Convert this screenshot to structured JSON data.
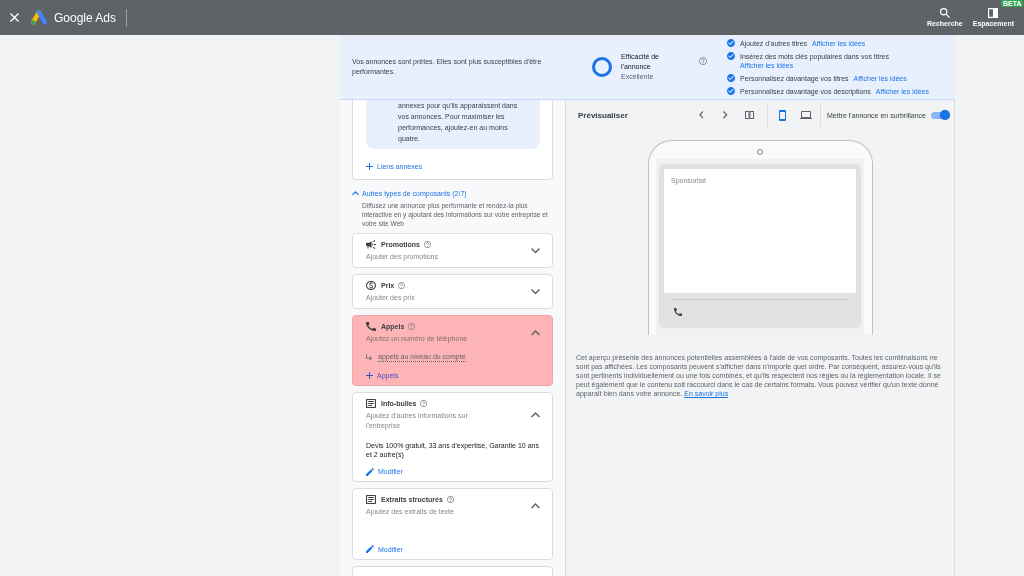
{
  "top_bar": {
    "product": "Google Ads",
    "actions": [
      {
        "kind": "search",
        "label": "Recherche"
      },
      {
        "kind": "layout",
        "label": "Espacement",
        "badge": "BETA"
      }
    ]
  },
  "banner": {
    "message": "Vos annonces sont prêtes. Elles sont plus susceptibles d'être performantes.",
    "strength": {
      "title": "Efficacité de l'annonce",
      "rating": "Excellente",
      "level": 1
    },
    "suggestions": [
      {
        "text": "Ajoutez d'autres titres",
        "link": "Afficher les idées",
        "done": true
      },
      {
        "text": "Insérez des mots clés populaires dans vos titres",
        "link": "Afficher les idées",
        "done": true
      },
      {
        "text": "Personnalisez davantage vos titres",
        "link": "Afficher les idées",
        "done": true
      },
      {
        "text": "Personnalisez davantage vos descriptions",
        "link": "Afficher les idées",
        "done": true
      }
    ]
  },
  "left_panel": {
    "sitelinks": {
      "info": "annexes pour qu'ils apparaissent dans vos annonces. Pour maximiser les performances, ajoutez-en au moins quatre.",
      "add_link": "Liens annexes"
    },
    "section": {
      "title": "Autres types de composants (2/7)",
      "expanded": true,
      "description": "Diffusez une annonce plus performante et rendez-la plus interactive en y ajoutant des informations sur votre entreprise et votre site Web"
    },
    "assets": [
      {
        "kind": "promotion",
        "title": "Promotions",
        "hint": "Ajouter des promotions",
        "expanded": false,
        "highlighted": false
      },
      {
        "kind": "price",
        "title": "Prix",
        "hint": "Ajouter des prix",
        "expanded": false,
        "highlighted": false
      },
      {
        "kind": "call",
        "title": "Appels",
        "hint": "Ajoutez un numéro de téléphone",
        "expanded": true,
        "highlighted": true,
        "account_level": "appels au niveau du compte",
        "add_link": "Appels"
      },
      {
        "kind": "callout",
        "title": "Info-bulles",
        "hint": "Ajoutez d'autres informations sur l'entreprise",
        "expanded": true,
        "highlighted": false,
        "summary": "Devis 100% gratuit, 33 ans d'expertise, Garantie 10 ans et 2 autre(s)",
        "edit_link": "Modifier"
      },
      {
        "kind": "snippet",
        "title": "Extraits structurés",
        "hint": "Ajoutez des extraits de texte",
        "expanded": true,
        "highlighted": false,
        "edit_link": "Modifier"
      }
    ]
  },
  "preview": {
    "title": "Prévisualiser",
    "devices": [
      {
        "kind": "mobile",
        "selected": true
      },
      {
        "kind": "desktop",
        "selected": false
      }
    ],
    "highlight_toggle": {
      "label": "Mettre l'annonce en surbrillance",
      "on": true
    },
    "ad": {
      "label": "Sponsorisé"
    },
    "disclaimer": {
      "text": "Cet aperçu présente des annonces potentielles assemblées à l'aide de vos composants. Toutes les combinaisons ne sont pas affichées. Les composants peuvent s'afficher dans n'importe quel ordre. Par conséquent, assurez-vous qu'ils sont pertinents individuellement ou une fois combinés, et qu'ils respectent nos règles ou la réglementation locale. Il se peut également que le contenu soit raccourci dans le cas de certains formats. Vous pouvez vérifier qu'un texte donné apparaît bien dans votre annonce.",
      "link": "En savoir plus"
    }
  }
}
